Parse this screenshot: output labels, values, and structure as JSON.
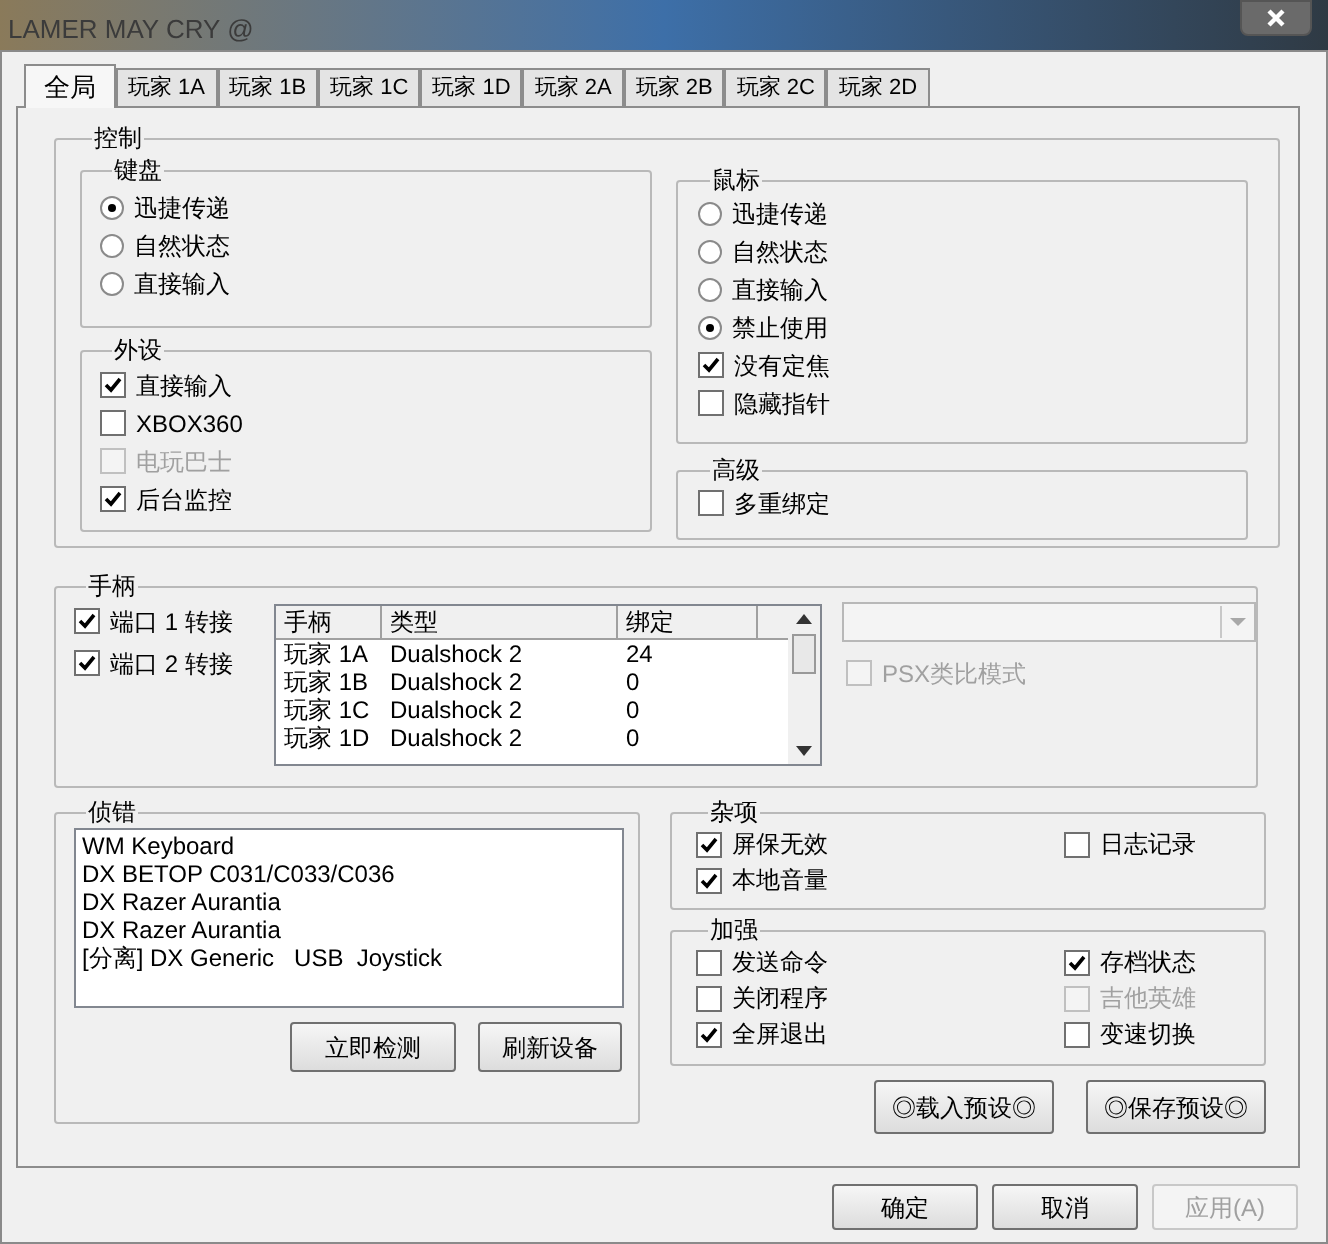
{
  "window": {
    "title": "LAMER MAY CRY @"
  },
  "tabs": [
    {
      "label": "全局",
      "selected": true
    },
    {
      "label": "玩家 1A",
      "selected": false
    },
    {
      "label": "玩家 1B",
      "selected": false
    },
    {
      "label": "玩家 1C",
      "selected": false
    },
    {
      "label": "玩家 1D",
      "selected": false
    },
    {
      "label": "玩家 2A",
      "selected": false
    },
    {
      "label": "玩家 2B",
      "selected": false
    },
    {
      "label": "玩家 2C",
      "selected": false
    },
    {
      "label": "玩家 2D",
      "selected": false
    }
  ],
  "control": {
    "label": "控制",
    "keyboard": {
      "label": "键盘",
      "options": [
        {
          "label": "迅捷传递",
          "selected": true
        },
        {
          "label": "自然状态",
          "selected": false
        },
        {
          "label": "直接输入",
          "selected": false
        }
      ]
    },
    "peripherals": {
      "label": "外设",
      "options": [
        {
          "label": "直接输入",
          "checked": true,
          "disabled": false
        },
        {
          "label": "XBOX360",
          "checked": false,
          "disabled": false
        },
        {
          "label": "电玩巴士",
          "checked": false,
          "disabled": true
        },
        {
          "label": "后台监控",
          "checked": true,
          "disabled": false
        }
      ]
    },
    "mouse": {
      "label": "鼠标",
      "options": [
        {
          "kind": "radio",
          "label": "迅捷传递",
          "selected": false
        },
        {
          "kind": "radio",
          "label": "自然状态",
          "selected": false
        },
        {
          "kind": "radio",
          "label": "直接输入",
          "selected": false
        },
        {
          "kind": "radio",
          "label": "禁止使用",
          "selected": true
        },
        {
          "kind": "checkbox",
          "label": "没有定焦",
          "checked": true
        },
        {
          "kind": "checkbox",
          "label": "隐藏指针",
          "checked": false
        }
      ]
    },
    "advanced": {
      "label": "高级",
      "options": [
        {
          "label": "多重绑定",
          "checked": false
        }
      ]
    }
  },
  "gamepad": {
    "label": "手柄",
    "ports": [
      {
        "label": "端口 1 转接",
        "checked": true
      },
      {
        "label": "端口 2 转接",
        "checked": true
      }
    ],
    "table": {
      "columns": [
        "手柄",
        "类型",
        "绑定"
      ],
      "rows": [
        [
          "玩家 1A",
          "Dualshock 2",
          "24"
        ],
        [
          "玩家 1B",
          "Dualshock 2",
          "0"
        ],
        [
          "玩家 1C",
          "Dualshock 2",
          "0"
        ],
        [
          "玩家 1D",
          "Dualshock 2",
          "0"
        ]
      ]
    },
    "dropdown": {
      "disabled": true
    },
    "psx_analog": {
      "label": "PSX类比模式",
      "checked": false,
      "disabled": true
    }
  },
  "debug": {
    "label": "侦错",
    "devices": [
      "WM Keyboard",
      "DX BETOP C031/C033/C036",
      "DX Razer Aurantia",
      "DX Razer Aurantia",
      "[分离] DX Generic   USB  Joystick"
    ],
    "buttons": [
      "立即检测",
      "刷新设备"
    ]
  },
  "misc": {
    "label": "杂项",
    "options": [
      {
        "label": "屏保无效",
        "checked": true,
        "disabled": false
      },
      {
        "label": "日志记录",
        "checked": false,
        "disabled": false
      },
      {
        "label": "本地音量",
        "checked": true,
        "disabled": false
      }
    ]
  },
  "enhance": {
    "label": "加强",
    "options": [
      {
        "label": "发送命令",
        "checked": false,
        "disabled": false
      },
      {
        "label": "存档状态",
        "checked": true,
        "disabled": false
      },
      {
        "label": "关闭程序",
        "checked": false,
        "disabled": false
      },
      {
        "label": "吉他英雄",
        "checked": false,
        "disabled": true
      },
      {
        "label": "全屏退出",
        "checked": true,
        "disabled": false
      },
      {
        "label": "变速切换",
        "checked": false,
        "disabled": false
      }
    ]
  },
  "preset_buttons": [
    "◎载入预设◎",
    "◎保存预设◎"
  ],
  "dialog_buttons": [
    {
      "label": "确定",
      "disabled": false
    },
    {
      "label": "取消",
      "disabled": false
    },
    {
      "label": "应用(A)",
      "disabled": true
    }
  ]
}
